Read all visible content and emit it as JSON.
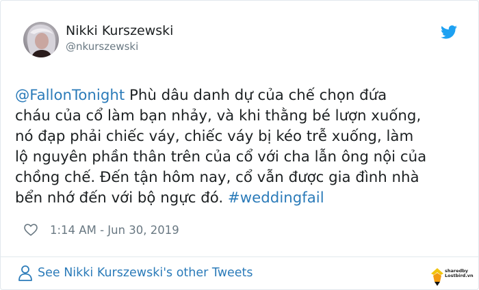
{
  "user": {
    "name": "Nikki Kurszewski",
    "handle": "@nkurszewski"
  },
  "tweet": {
    "mention": "@FallonTonight",
    "body": " Phù dâu danh dự của chế chọn đứa\ncháu của cổ làm bạn nhảy, và khi thằng bé lượn xuống,\nnó đạp phải chiếc váy, chiếc váy bị kéo trễ xuống, làm\nlộ nguyên phần thân trên của cổ với cha lẫn ông nội của\nchồng chế. Đến tận hôm nay, cổ vẫn được gia đình nhà\nbển nhớ đến với bộ ngực đó. ",
    "hashtag": "#weddingfail",
    "timestamp": "1:14 AM - Jun 30, 2019"
  },
  "footer": {
    "other_tweets_label": "See Nikki Kurszewski's other Tweets"
  },
  "watermark": {
    "line1": "sharedby",
    "line2": "Lostbird.vn"
  },
  "icons": {
    "bird": "twitter-bird-icon",
    "heart": "heart-icon",
    "person": "person-icon"
  },
  "colors": {
    "link": "#2b7bb9",
    "twitter_blue": "#1da1f2",
    "muted": "#697882",
    "text": "#1c2022"
  }
}
